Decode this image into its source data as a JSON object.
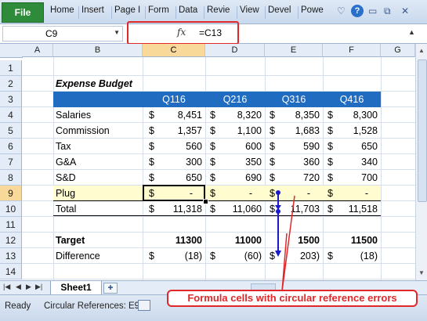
{
  "ribbon": {
    "file_label": "File",
    "tabs": [
      "Home",
      "Insert",
      "Page I",
      "Form",
      "Data",
      "Revie",
      "View",
      "Devel",
      "Powe"
    ]
  },
  "formula_bar": {
    "name_box": "C9",
    "fx_label": "fx",
    "formula": "=C13"
  },
  "grid": {
    "columns": [
      "A",
      "B",
      "C",
      "D",
      "E",
      "F",
      "G"
    ],
    "selected_column": "C",
    "rows": [
      "1",
      "2",
      "3",
      "4",
      "5",
      "6",
      "7",
      "8",
      "9",
      "10",
      "11",
      "12",
      "13",
      "14"
    ],
    "selected_row": "9",
    "title": "Expense Budget",
    "quarters": [
      "Q116",
      "Q216",
      "Q316",
      "Q416"
    ],
    "currency": "$",
    "line_items": [
      {
        "label": "Salaries",
        "values": [
          "8,451",
          "8,320",
          "8,350",
          "8,300"
        ]
      },
      {
        "label": "Commission",
        "values": [
          "1,357",
          "1,100",
          "1,683",
          "1,528"
        ]
      },
      {
        "label": "Tax",
        "values": [
          "560",
          "600",
          "590",
          "650"
        ]
      },
      {
        "label": "G&A",
        "values": [
          "300",
          "350",
          "360",
          "340"
        ]
      },
      {
        "label": "S&D",
        "values": [
          "650",
          "690",
          "720",
          "700"
        ]
      },
      {
        "label": "Plug",
        "values": [
          "-",
          "-",
          "-",
          "-"
        ]
      }
    ],
    "total": {
      "label": "Total",
      "values": [
        "11,318",
        "11,060",
        "11,703",
        "11,518"
      ]
    },
    "target": {
      "label": "Target",
      "values": [
        "11300",
        "11000",
        "1500",
        "11500"
      ]
    },
    "difference": {
      "label": "Difference",
      "values": [
        "(18)",
        "(60)",
        "203)",
        "(18)"
      ]
    }
  },
  "sheets": {
    "active": "Sheet1"
  },
  "status": {
    "ready": "Ready",
    "circular": "Circular References: E9"
  },
  "callout": "Formula cells with circular reference errors",
  "colors": {
    "header_blue": "#1f6cc1",
    "plug_yellow": "#fffdd0",
    "annotation_red": "#e0282a",
    "tracer_blue": "#1a1acc",
    "file_green": "#2e8b3a"
  }
}
